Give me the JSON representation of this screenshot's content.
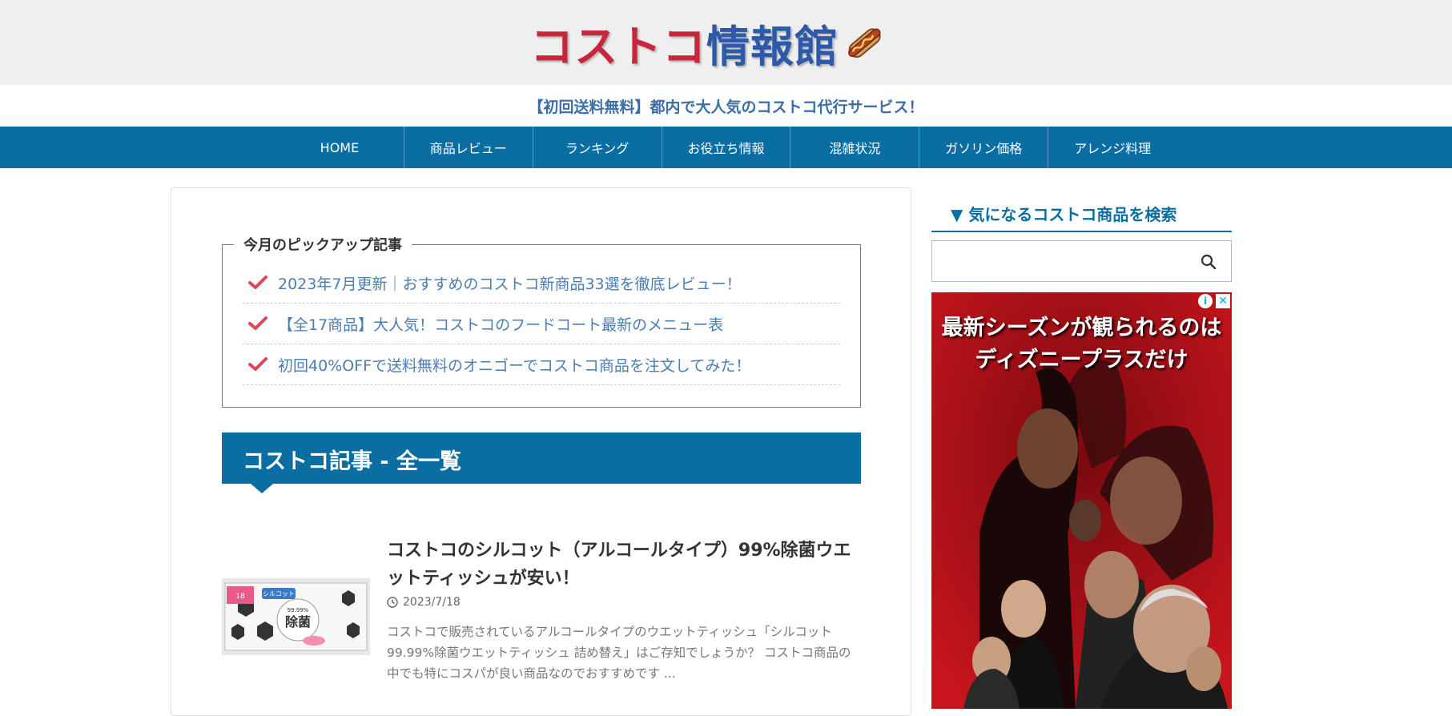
{
  "header": {
    "logo_red": "コストコ",
    "logo_blue": "情報館",
    "logo_icon": "hotdog-icon",
    "tagline": "【初回送料無料】都内で大人気のコストコ代行サービス！"
  },
  "nav": {
    "items": [
      {
        "label": "HOME"
      },
      {
        "label": "商品レビュー"
      },
      {
        "label": "ランキング"
      },
      {
        "label": "お役立ち情報"
      },
      {
        "label": "混雑状況"
      },
      {
        "label": "ガソリン価格"
      },
      {
        "label": "アレンジ料理"
      }
    ]
  },
  "pickup": {
    "title": "今月のピックアップ記事",
    "items": [
      {
        "label": "2023年7月更新｜おすすめのコストコ新商品33選を徹底レビュー！"
      },
      {
        "label": "【全17商品】大人気！コストコのフードコート最新のメニュー表"
      },
      {
        "label": "初回40%OFFで送料無料のオニゴーでコストコ商品を注文してみた！"
      }
    ]
  },
  "section": {
    "heading": "コストコ記事 - 全一覧"
  },
  "article": {
    "title": "コストコのシルコット（アルコールタイプ）99%除菌ウエットティッシュが安い！",
    "date": "2023/7/18",
    "excerpt": "コストコで販売されているアルコールタイプのウエットティッシュ「シルコット99.99%除菌ウエットティッシュ 詰め替え」はご存知でしょうか？ コストコ商品の中でも特にコスパが良い商品なのでおすすめです ...",
    "thumb_label": "シルコット",
    "thumb_main": "除菌",
    "thumb_pct": "99.99%",
    "thumb_count": "18"
  },
  "sidebar": {
    "search_title": "▼ 気になるコストコ商品を検索",
    "search_placeholder": ""
  },
  "ad": {
    "line1": "最新シーズンが観られるのは",
    "line2": "ディズニープラスだけ",
    "info_icon": "info-icon",
    "close_icon": "close-icon"
  },
  "colors": {
    "nav_bg": "#0a6ea3",
    "logo_red": "#c8263a",
    "logo_blue": "#2d5aa8",
    "link": "#4a7db3",
    "check": "#d9485f"
  }
}
